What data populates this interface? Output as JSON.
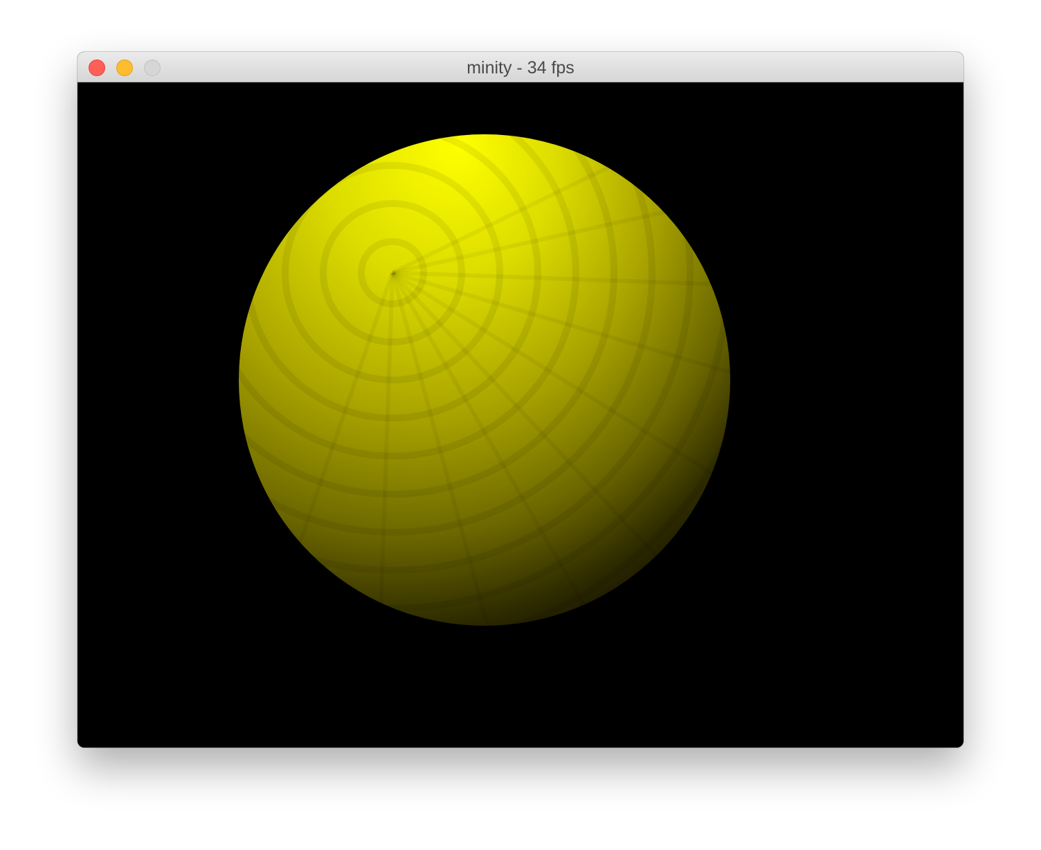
{
  "window": {
    "title": "minity - 34 fps",
    "buttons": {
      "close": "close-button",
      "minimize": "minimize-button",
      "zoom": "zoom-button"
    }
  },
  "scene": {
    "background_color": "#000000",
    "sphere_color": "#ffff00",
    "shading": "faceted-lit"
  }
}
